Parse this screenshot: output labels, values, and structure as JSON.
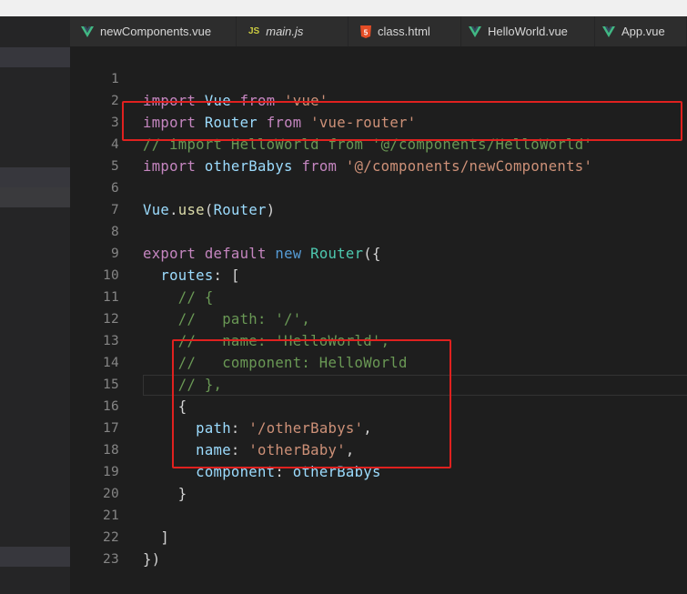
{
  "tabs": [
    {
      "label": "newComponents.vue",
      "icon": "vue-icon",
      "active": false
    },
    {
      "label": "main.js",
      "icon": "js-icon",
      "italic": true,
      "active": false
    },
    {
      "label": "class.html",
      "icon": "html5-icon",
      "active": false
    },
    {
      "label": "HelloWorld.vue",
      "icon": "vue-icon",
      "active": false
    },
    {
      "label": "App.vue",
      "icon": "vue-icon",
      "active": false
    }
  ],
  "icon_glyphs": {
    "js": "JS",
    "html": "5"
  },
  "colors": {
    "vue_icon": "#41b883",
    "js_icon": "#cbcb41",
    "html_icon": "#e44d26",
    "highlight_box": "#e0211f",
    "keyword": "#c586c0",
    "string": "#ce9178",
    "comment": "#6a9955"
  },
  "code": {
    "line_numbers": [
      "1",
      "2",
      "3",
      "4",
      "5",
      "6",
      "7",
      "8",
      "9",
      "10",
      "11",
      "12",
      "13",
      "14",
      "15",
      "16",
      "17",
      "18",
      "19",
      "20",
      "21",
      "22",
      "23"
    ],
    "t": {
      "import": "import",
      "from": "from",
      "Vue": "Vue",
      "Router": "Router",
      "s_vue": "'vue'",
      "s_vue_router": "'vue-router'",
      "l3": "// import HelloWorld from '@/components/HelloWorld'",
      "otherBabys": "otherBabys",
      "s_newComponents": "'@/components/newComponents'",
      "dot": ".",
      "use": "use",
      "lparen": "(",
      "rparen": ")",
      "export": "export",
      "default": "default",
      "new": "new",
      "lparen_brace": "({",
      "routes": "routes",
      "colon": ":",
      "lbracket": "[",
      "l10": "// {",
      "l11": "//   path: '/',",
      "l12": "//   name: 'HelloWorld',",
      "l13": "//   component: HelloWorld",
      "l14": "// },",
      "lbrace": "{",
      "path": "path",
      "s_otherBabys_path": "'/otherBabys'",
      "comma": ",",
      "name": "name",
      "s_otherBaby": "'otherBaby'",
      "component": "component",
      "rbrace": "}",
      "rbracket": "]",
      "rbrace_paren": "})"
    }
  }
}
